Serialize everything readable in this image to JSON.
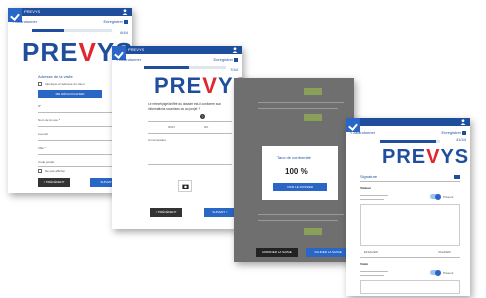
{
  "s1": {
    "app_title": "PREVYS",
    "back": "< Abandonner",
    "save": "Enregistrer",
    "counter": "6/44",
    "brand_pre": "PRE",
    "brand_v": "V",
    "brand_post": "YS",
    "section": "Adresse de la visite",
    "checkbox_label": "Identique à l'adresse du client",
    "geoloc_button": "ME GÉOLOCALISER",
    "fields": [
      "N°",
      "Nom de la voie *",
      "Lieu-dit",
      "Ville *",
      "Code postal",
      "Autre référence"
    ],
    "checkbox2": "Ne pas afficher",
    "prev": "< PRÉCÉDENT",
    "next": "SUIVANT >"
  },
  "s2": {
    "app_title": "PREVYS",
    "back": "< Abandonner",
    "save": "Enregistrer",
    "counter": "7/44",
    "brand_pre": "PRE",
    "brand_v": "V",
    "brand_post": "YS",
    "question": "Le relevé/pigé/chiffré du dossier est-il conforme aux informations soumises ou au projet ?",
    "opt_non": "NON",
    "opt_nc": "NC",
    "comment_label": "Commentaire",
    "prev": "< PRÉCÉDENT",
    "next": "SUIVANT >"
  },
  "s3": {
    "modal_title": "Taux de conformité",
    "modal_value": "100 %",
    "modal_button": "VOIR LE DOSSIER",
    "bottom_left": "MODIFIER LA SAISIE",
    "bottom_right": "VALIDER LA SAISIE"
  },
  "s4": {
    "back": "< Abandonner",
    "save": "Enregistrer",
    "counter": "41/44",
    "brand_pre": "PRE",
    "brand_v": "V",
    "brand_post": "YS",
    "signature_title": "Signature",
    "signer1": "Visiteur",
    "toggle_label": "Présent",
    "erase": "EFFACER",
    "validate": "VALIDER",
    "signer2": "Visité"
  },
  "colors": {
    "primary": "#1f4f9c",
    "accent": "#e1262d",
    "button": "#2a66c6",
    "dark": "#333333"
  }
}
